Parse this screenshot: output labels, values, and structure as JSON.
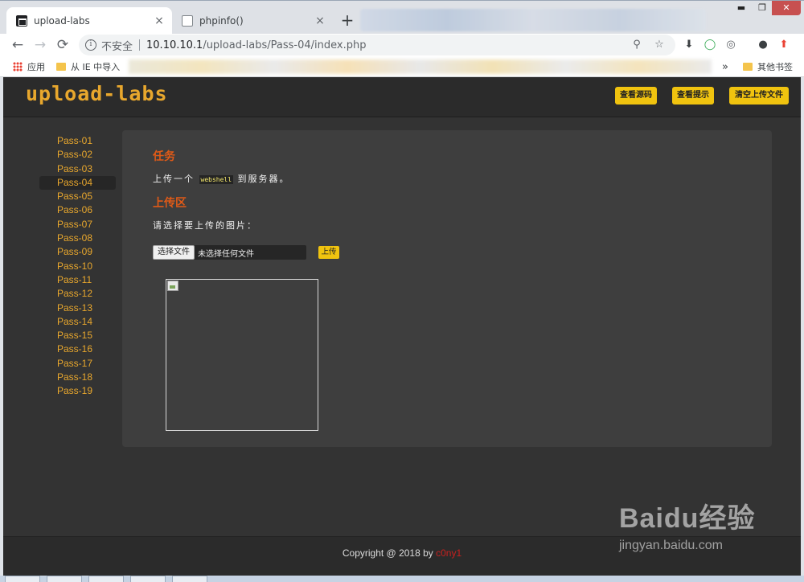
{
  "browser": {
    "tabs": [
      {
        "title": "upload-labs",
        "close": "×"
      },
      {
        "title": "phpinfo()",
        "close": "×"
      }
    ],
    "new_tab": "+",
    "window_controls": {
      "minimize": "▬",
      "maximize": "❐",
      "close": "✕"
    },
    "nav": {
      "back": "←",
      "forward": "→",
      "reload": "⟳"
    },
    "address": {
      "security_label": "不安全",
      "host": "10.10.10.1",
      "path": "/upload-labs/Pass-04/index.php"
    },
    "bookmarks": {
      "apps": "应用",
      "ie_import": "从 IE 中导入",
      "overflow": "»",
      "other": "其他书签"
    }
  },
  "site": {
    "logo": "upload-labs",
    "header_buttons": [
      "查看源码",
      "查看提示",
      "清空上传文件"
    ],
    "nav": [
      "Pass-01",
      "Pass-02",
      "Pass-03",
      "Pass-04",
      "Pass-05",
      "Pass-06",
      "Pass-07",
      "Pass-08",
      "Pass-09",
      "Pass-10",
      "Pass-11",
      "Pass-12",
      "Pass-13",
      "Pass-14",
      "Pass-15",
      "Pass-16",
      "Pass-17",
      "Pass-18",
      "Pass-19"
    ],
    "active_nav": "Pass-04",
    "task": {
      "heading": "任务",
      "desc_before": "上传一个",
      "desc_code": "webshell",
      "desc_after": "到服务器。"
    },
    "upload": {
      "heading": "上传区",
      "prompt": "请选择要上传的图片：",
      "choose_file": "选择文件",
      "no_file": "未选择任何文件",
      "submit": "上传"
    },
    "footer": {
      "text": "Copyright @ 2018 by ",
      "author": "c0ny1"
    }
  },
  "watermark": {
    "logo": "Baidu经验",
    "url": "jingyan.baidu.com"
  },
  "colors": {
    "accent": "#e8a72d",
    "button": "#f0c30f",
    "heading": "#e05a17",
    "page_bg": "#333333",
    "author": "#c8201e"
  }
}
